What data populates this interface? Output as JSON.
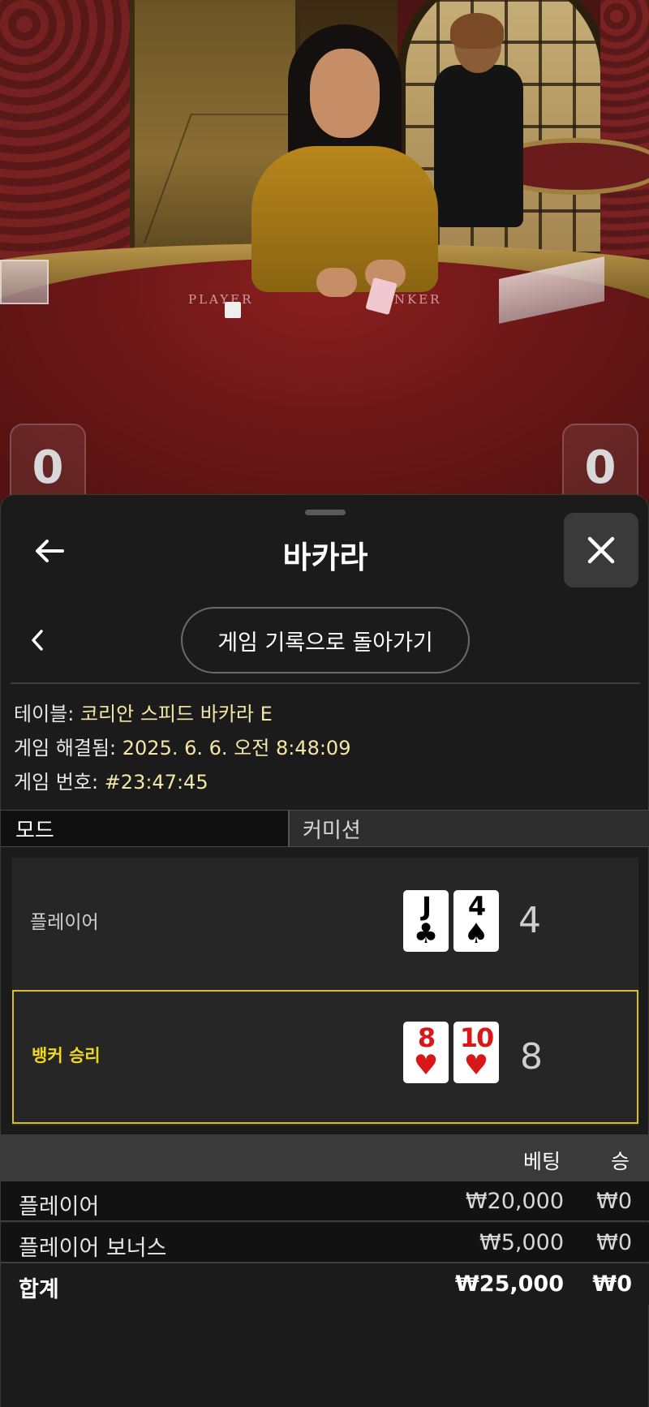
{
  "video": {
    "felt_labels": {
      "player": "PLAYER",
      "banker": "BANKER"
    },
    "player_score": "0",
    "banker_score": "0"
  },
  "sheet": {
    "title": "바카라",
    "back_icon": "arrow-left-icon",
    "close_icon": "close-x-icon",
    "return_button": "게임 기록으로 돌아가기",
    "prev_icon": "chevron-left-icon"
  },
  "info": {
    "table_label": "테이블:",
    "table_value": "코리안 스피드 바카라 E",
    "resolved_label": "게임 해결됨:",
    "resolved_value": "2025. 6. 6. 오전 8:48:09",
    "game_no_label": "게임 번호:",
    "game_no_value": "#23:47:45"
  },
  "mode": {
    "label": "모드",
    "value": "커미션"
  },
  "result": {
    "player": {
      "label": "플레이어",
      "total": "4",
      "cards": [
        {
          "rank": "J",
          "suit": "♣",
          "color": "black"
        },
        {
          "rank": "4",
          "suit": "♠",
          "color": "black"
        }
      ]
    },
    "banker": {
      "label": "뱅커 승리",
      "total": "8",
      "cards": [
        {
          "rank": "8",
          "suit": "♥",
          "color": "red"
        },
        {
          "rank": "10",
          "suit": "♥",
          "color": "red"
        }
      ]
    },
    "highlight_color": "#d8bf1e"
  },
  "bets": {
    "header": {
      "bet": "베팅",
      "win": "승"
    },
    "rows": [
      {
        "name": "플레이어",
        "bet": "₩20,000",
        "win": "₩0"
      },
      {
        "name": "플레이어 보너스",
        "bet": "₩5,000",
        "win": "₩0"
      }
    ],
    "total": {
      "name": "합계",
      "bet": "₩25,000",
      "win": "₩0"
    }
  }
}
